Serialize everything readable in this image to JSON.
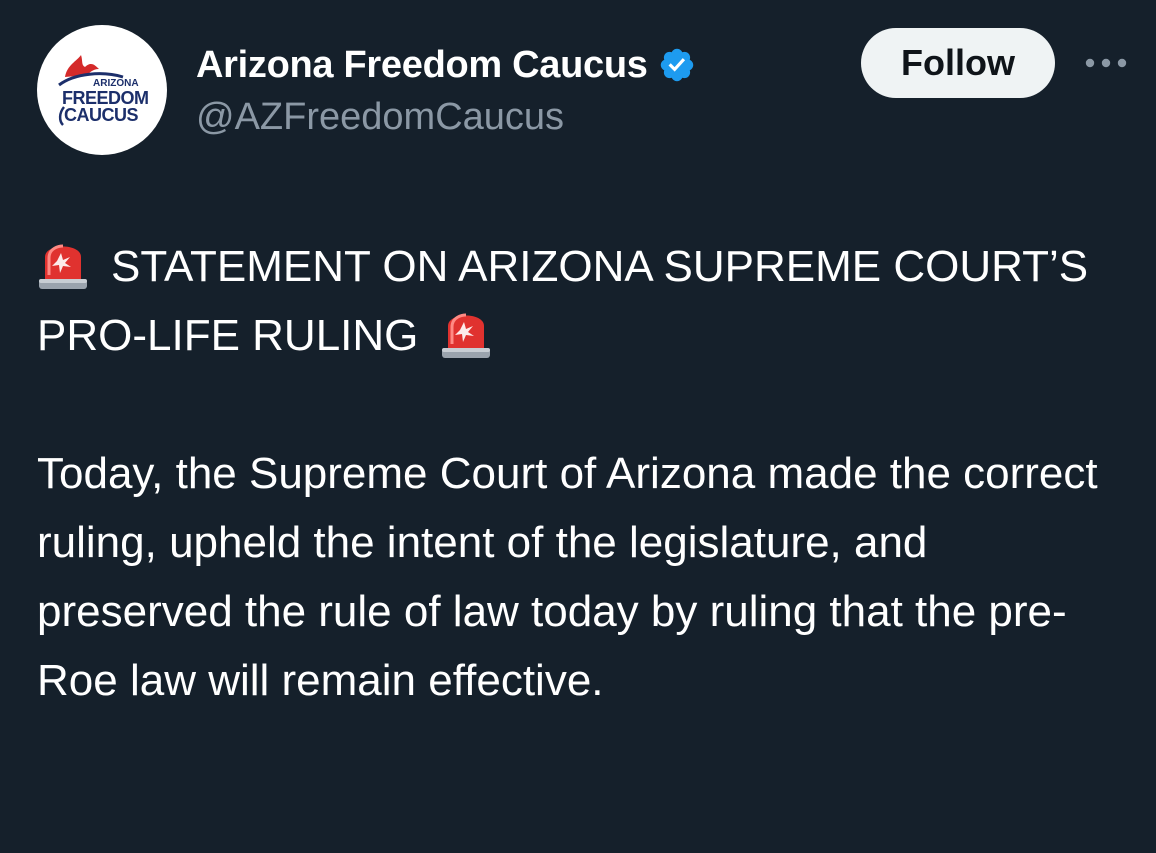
{
  "author": {
    "display_name": "Arizona Freedom Caucus",
    "handle": "@AZFreedomCaucus",
    "verified": true,
    "avatar_text": [
      "ARIZONA",
      "FREEDOM",
      "CAUCUS"
    ]
  },
  "actions": {
    "follow_label": "Follow",
    "more_icon": "more-dots-icon"
  },
  "tweet": {
    "headline": "STATEMENT ON ARIZONA SUPREME COURT’S PRO-LIFE RULING",
    "headline_icon": "siren-icon",
    "body": "Today, the Supreme Court of Arizona made the correct ruling, upheld the intent of the legislature, and preserved the rule of law today by ruling that the pre-Roe law will remain effective."
  },
  "colors": {
    "background": "#15202b",
    "text": "#ffffff",
    "secondary_text": "#8b98a5",
    "verified_blue": "#1d9bf0",
    "follow_button_bg": "#eff3f4",
    "logo_navy": "#1c2f6b",
    "logo_red": "#d42a2a"
  }
}
